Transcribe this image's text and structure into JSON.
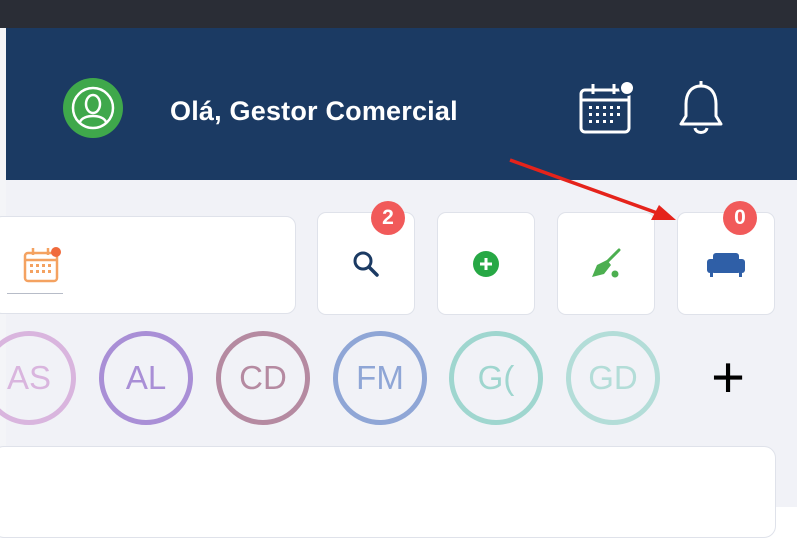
{
  "header": {
    "greeting": "Olá, Gestor Comercial",
    "colors": {
      "background": "#1b3a63",
      "avatar": "#3fa84b"
    }
  },
  "toolbar": {
    "search": {
      "icon": "search-icon",
      "badge": "2"
    },
    "add": {
      "icon": "plus-circle-icon"
    },
    "clean": {
      "icon": "broom-icon"
    },
    "sofa": {
      "icon": "sofa-icon",
      "badge": "0"
    }
  },
  "users": [
    {
      "initials": "AS",
      "color": "#d9b5de"
    },
    {
      "initials": "AL",
      "color": "#a98fd6"
    },
    {
      "initials": "CD",
      "color": "#b58aa1"
    },
    {
      "initials": "FM",
      "color": "#8fa6d6"
    },
    {
      "initials": "G(",
      "color": "#9fd6cf"
    },
    {
      "initials": "GD",
      "color": "#b3ddd8"
    }
  ],
  "add_user_label": "+"
}
